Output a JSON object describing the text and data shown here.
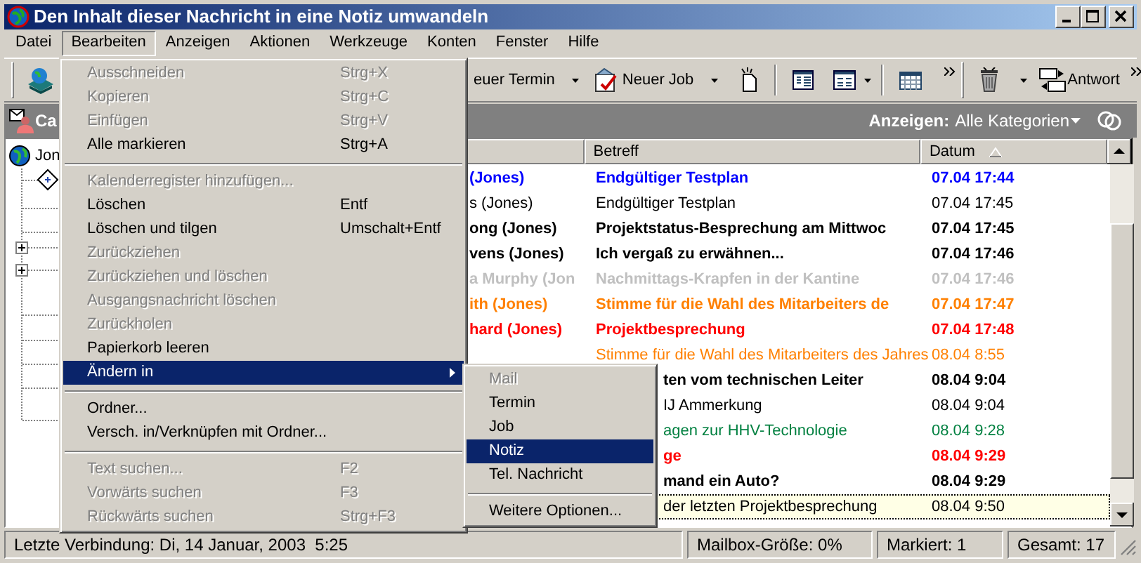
{
  "window": {
    "title": "Den Inhalt dieser Nachricht in eine Notiz umwandeln"
  },
  "menu_bar": [
    {
      "label": "Datei",
      "selected": false
    },
    {
      "label": "Bearbeiten",
      "selected": true
    },
    {
      "label": "Anzeigen",
      "selected": false
    },
    {
      "label": "Aktionen",
      "selected": false
    },
    {
      "label": "Werkzeuge",
      "selected": false
    },
    {
      "label": "Konten",
      "selected": false
    },
    {
      "label": "Fenster",
      "selected": false
    },
    {
      "label": "Hilfe",
      "selected": false
    }
  ],
  "toolbar": {
    "buttons": [
      "euer Termin",
      "Neuer Job",
      "Antwort"
    ]
  },
  "folder_bar": {
    "title": "Ca",
    "filter_label": "Anzeigen:",
    "filter_value": "Alle Kategorien"
  },
  "folder_tree": {
    "root": "Jon"
  },
  "message_list": {
    "columns": [
      {
        "label": "Betreff",
        "sorted": false
      },
      {
        "label": "Datum",
        "sorted": true
      }
    ],
    "rows": [
      {
        "kind": "open",
        "sender": "(Jones)",
        "subject": "Endgültiger Testplan",
        "date": "07.04 17:44",
        "color": "#0000ff",
        "bold": true,
        "selected": false
      },
      {
        "kind": "open",
        "sender": "s (Jones)",
        "subject": "Endgültiger Testplan",
        "date": "07.04 17:45",
        "color": "#000000",
        "bold": false,
        "selected": false
      },
      {
        "kind": "open",
        "sender": "ong (Jones)",
        "subject": "Projektstatus-Besprechung am Mittwoc",
        "date": "07.04 17:45",
        "color": "#000000",
        "bold": true,
        "selected": false
      },
      {
        "kind": "open",
        "sender": "vens (Jones)",
        "subject": "Ich vergaß zu erwähnen...",
        "date": "07.04 17:46",
        "color": "#000000",
        "bold": true,
        "selected": false
      },
      {
        "kind": "open",
        "sender": "a Murphy (Jon",
        "subject": "Nachmittags-Krapfen in der Kantine",
        "date": "07.04 17:46",
        "color": "#c0c0c0",
        "bold": true,
        "selected": false
      },
      {
        "kind": "open",
        "sender": "ith (Jones)",
        "subject": "Stimme für die Wahl des Mitarbeiters de",
        "date": "07.04 17:47",
        "color": "#ff8000",
        "bold": true,
        "selected": false
      },
      {
        "kind": "open",
        "sender": "hard (Jones)",
        "subject": "Projektbesprechung",
        "date": "07.04 17:48",
        "color": "#ff0000",
        "bold": true,
        "selected": false
      },
      {
        "kind": "open",
        "subject": "Stimme für die Wahl des Mitarbeiters des Jahres",
        "date": "08.04 8:55",
        "color": "#ff8000",
        "bold": false,
        "selected": false
      },
      {
        "kind": "covered",
        "subject": "ten vom technischen Leiter",
        "date": "08.04 9:04",
        "color": "#000000",
        "bold": true,
        "selected": false
      },
      {
        "kind": "covered",
        "subject": "IJ Ammerkung",
        "date": "08.04 9:04",
        "color": "#000000",
        "bold": false,
        "selected": false
      },
      {
        "kind": "covered",
        "subject": "agen zur HHV-Technologie",
        "date": "08.04 9:28",
        "color": "#008040",
        "bold": false,
        "selected": false
      },
      {
        "kind": "covered",
        "subject": "ge",
        "date": "08.04 9:29",
        "color": "#ff0000",
        "bold": true,
        "selected": false
      },
      {
        "kind": "covered",
        "subject": "mand ein Auto?",
        "date": "08.04 9:29",
        "color": "#000000",
        "bold": true,
        "selected": false
      },
      {
        "kind": "covered",
        "subject": "der letzten Projektbesprechung",
        "date": "08.04 9:50",
        "color": "#000000",
        "bold": false,
        "selected": true
      }
    ]
  },
  "edit_menu": {
    "items": [
      {
        "kind": "item",
        "label": "Ausschneiden",
        "shortcut": "Strg+X",
        "disabled": true,
        "selected": false
      },
      {
        "kind": "item",
        "label": "Kopieren",
        "shortcut": "Strg+C",
        "disabled": true,
        "selected": false
      },
      {
        "kind": "item",
        "label": "Einfügen",
        "shortcut": "Strg+V",
        "disabled": true,
        "selected": false
      },
      {
        "kind": "item",
        "label": "Alle markieren",
        "shortcut": "Strg+A",
        "disabled": false,
        "selected": false
      },
      {
        "kind": "separator"
      },
      {
        "kind": "item",
        "label": "Kalenderregister hinzufügen...",
        "disabled": true,
        "selected": false
      },
      {
        "kind": "item",
        "label": "Löschen",
        "shortcut": "Entf",
        "disabled": false,
        "selected": false
      },
      {
        "kind": "item",
        "label": "Löschen und tilgen",
        "shortcut": "Umschalt+Entf",
        "disabled": false,
        "selected": false
      },
      {
        "kind": "item",
        "label": "Zurückziehen",
        "disabled": true,
        "selected": false
      },
      {
        "kind": "item",
        "label": "Zurückziehen und löschen",
        "disabled": true,
        "selected": false
      },
      {
        "kind": "item",
        "label": "Ausgangsnachricht löschen",
        "disabled": true,
        "selected": false
      },
      {
        "kind": "item",
        "label": "Zurückholen",
        "disabled": true,
        "selected": false
      },
      {
        "kind": "item",
        "label": "Papierkorb leeren",
        "disabled": false,
        "selected": false
      },
      {
        "kind": "submenu",
        "label": "Ändern in",
        "disabled": false,
        "selected": true
      },
      {
        "kind": "separator"
      },
      {
        "kind": "item",
        "label": "Ordner...",
        "disabled": false,
        "selected": false
      },
      {
        "kind": "item",
        "label": "Versch. in/Verknüpfen mit Ordner...",
        "disabled": false,
        "selected": false
      },
      {
        "kind": "separator"
      },
      {
        "kind": "item",
        "label": "Text suchen...",
        "shortcut": "F2",
        "disabled": true,
        "selected": false
      },
      {
        "kind": "item",
        "label": "Vorwärts suchen",
        "shortcut": "F3",
        "disabled": true,
        "selected": false
      },
      {
        "kind": "item",
        "label": "Rückwärts suchen",
        "shortcut": "Strg+F3",
        "disabled": true,
        "selected": false
      }
    ]
  },
  "submenu": {
    "items": [
      {
        "kind": "item",
        "label": "Mail",
        "disabled": true,
        "selected": false
      },
      {
        "kind": "item",
        "label": "Termin",
        "disabled": false,
        "selected": false
      },
      {
        "kind": "item",
        "label": "Job",
        "disabled": false,
        "selected": false
      },
      {
        "kind": "item",
        "label": "Notiz",
        "disabled": false,
        "selected": true
      },
      {
        "kind": "item",
        "label": "Tel. Nachricht",
        "disabled": false,
        "selected": false
      },
      {
        "kind": "separator"
      },
      {
        "kind": "item",
        "label": "Weitere Optionen...",
        "disabled": false,
        "selected": false
      }
    ]
  },
  "status_bar": [
    "Letzte Verbindung: Di, 14 Januar, 2003  5:25",
    "Mailbox-Größe: 0%",
    "Markiert: 1",
    "Gesamt: 17"
  ]
}
